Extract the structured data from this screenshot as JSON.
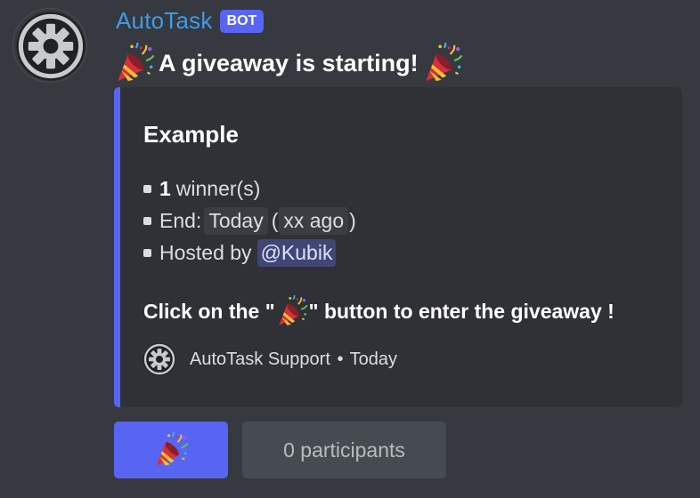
{
  "author": {
    "username": "AutoTask",
    "badge": "BOT",
    "avatar_icon": "gear-icon"
  },
  "message": {
    "text": "A giveaway is starting!",
    "leading_emoji": "tada-icon",
    "trailing_emoji": "tada-icon"
  },
  "embed": {
    "accent_color": "#5865f2",
    "title": "Example",
    "winners_count": "1",
    "winners_label": "winner(s)",
    "end_label": "End:",
    "end_value": "Today",
    "end_relative": "xx ago",
    "hosted_label": "Hosted by",
    "host_mention": "@Kubik",
    "cta_prefix": "Click on the \"",
    "cta_suffix": "\" button to enter the giveaway !",
    "footer_text": "AutoTask Support",
    "footer_separator": "•",
    "footer_time": "Today"
  },
  "buttons": {
    "enter_icon": "tada-icon",
    "participants_label": "0 participants"
  },
  "colors": {
    "background": "#36393f",
    "embed_background": "#2f3136",
    "blurple": "#5865f2",
    "username": "#3f9be8"
  }
}
